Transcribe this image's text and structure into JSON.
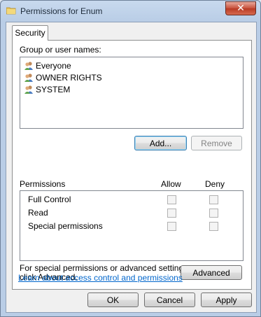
{
  "window": {
    "title": "Permissions for Enum",
    "close_glyph": "✕"
  },
  "tabs": [
    {
      "label": "Security"
    }
  ],
  "group_label": "Group or user names:",
  "users": [
    {
      "name": "Everyone",
      "icon": "users-icon"
    },
    {
      "name": "OWNER RIGHTS",
      "icon": "users-icon"
    },
    {
      "name": "SYSTEM",
      "icon": "users-icon"
    }
  ],
  "buttons": {
    "add": "Add...",
    "remove": "Remove",
    "advanced": "Advanced",
    "ok": "OK",
    "cancel": "Cancel",
    "apply": "Apply"
  },
  "permissions": {
    "label": "Permissions",
    "allow_header": "Allow",
    "deny_header": "Deny",
    "rows": [
      {
        "name": "Full Control",
        "allow": false,
        "deny": false
      },
      {
        "name": "Read",
        "allow": false,
        "deny": false
      },
      {
        "name": "Special permissions",
        "allow": false,
        "deny": false
      }
    ]
  },
  "advanced_note": "For special permissions or advanced settings, click Advanced.",
  "advanced_note_lines": [
    "For special permissions or advanced settings,",
    "click Advanced."
  ],
  "learn_link": "Learn about access control and permissions",
  "colors": {
    "link": "#0066cc",
    "title_bar": "#b9cde6",
    "close": "#c7503b"
  }
}
